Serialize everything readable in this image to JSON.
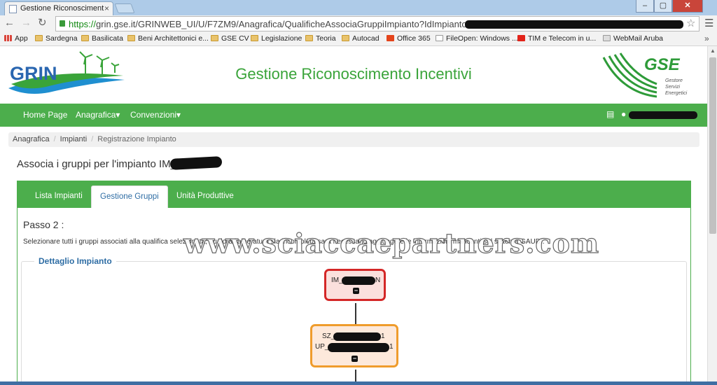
{
  "browser": {
    "tab_title": "Gestione Riconosciment",
    "tab_close": "×",
    "window_buttons": {
      "minimize": "–",
      "maximize": "▢",
      "close": "✕"
    },
    "url_https": "https://",
    "url_rest": "grin.gse.it/GRINWEB_UI/U/F7ZM9/Anagrafica/QualificheAssociaGruppiImpianto?IdImpianto=9",
    "bookmarks": [
      {
        "label": "App",
        "icon": "apps-icon"
      },
      {
        "label": "Sardegna",
        "icon": "folder-icon"
      },
      {
        "label": "Basilicata",
        "icon": "folder-icon"
      },
      {
        "label": "Beni Architettonici e...",
        "icon": "folder-icon"
      },
      {
        "label": "GSE CV",
        "icon": "folder-icon"
      },
      {
        "label": "Legislazione",
        "icon": "folder-icon"
      },
      {
        "label": "Teoria",
        "icon": "folder-icon"
      },
      {
        "label": "Autocad",
        "icon": "folder-icon"
      },
      {
        "label": "Office 365",
        "icon": "office-icon"
      },
      {
        "label": "FileOpen: Windows ...",
        "icon": "document-icon"
      },
      {
        "label": "TIM e Telecom in u...",
        "icon": "tim-icon"
      },
      {
        "label": "WebMail Aruba",
        "icon": "mail-icon"
      }
    ],
    "bookmarks_more": "»"
  },
  "header": {
    "site_title": "Gestione Riconoscimento Incentivi",
    "grin_logo_text": "GRIN",
    "gse_logo_text": "GSE",
    "gse_logo_sub": [
      "Gestore",
      "Servizi",
      "Energetici"
    ]
  },
  "nav": {
    "items": [
      "Home Page",
      "Anagrafica",
      "Convenzioni"
    ],
    "dropdown_caret": "▾"
  },
  "breadcrumb": [
    "Anagrafica",
    "Impianti",
    "Registrazione Impianto"
  ],
  "page": {
    "heading": "Associa i gruppi per l'impianto IM_",
    "tabs": [
      "Lista Impianti",
      "Gestione Gruppi",
      "Unità Produttive"
    ],
    "active_tab": "Gestione Gruppi",
    "step_title": "Passo 2 :",
    "instructions": "Selezionare tutti i gruppi associati alla qualifica selezionata, qualora l'alberatura sia incompleta sarà necessario aggiungere le informazioni mancanti sul sistema GAUDI.",
    "fieldset_legend": "Dettaglio Impianto",
    "tree": {
      "root": {
        "label_prefix": "IM_",
        "label_suffix": "N"
      },
      "child": {
        "line1_prefix": "SZ_",
        "line1_suffix": "1",
        "line2_prefix": "UP_",
        "line2_suffix": "1"
      },
      "collapse_symbol": "−"
    }
  },
  "watermark": "www.sciaccaepartners.com",
  "colors": {
    "brand_green": "#4cae4c",
    "title_green": "#3aa43a",
    "link_blue": "#2e6da4",
    "root_border": "#d42727",
    "child_border": "#ef9c2c"
  }
}
